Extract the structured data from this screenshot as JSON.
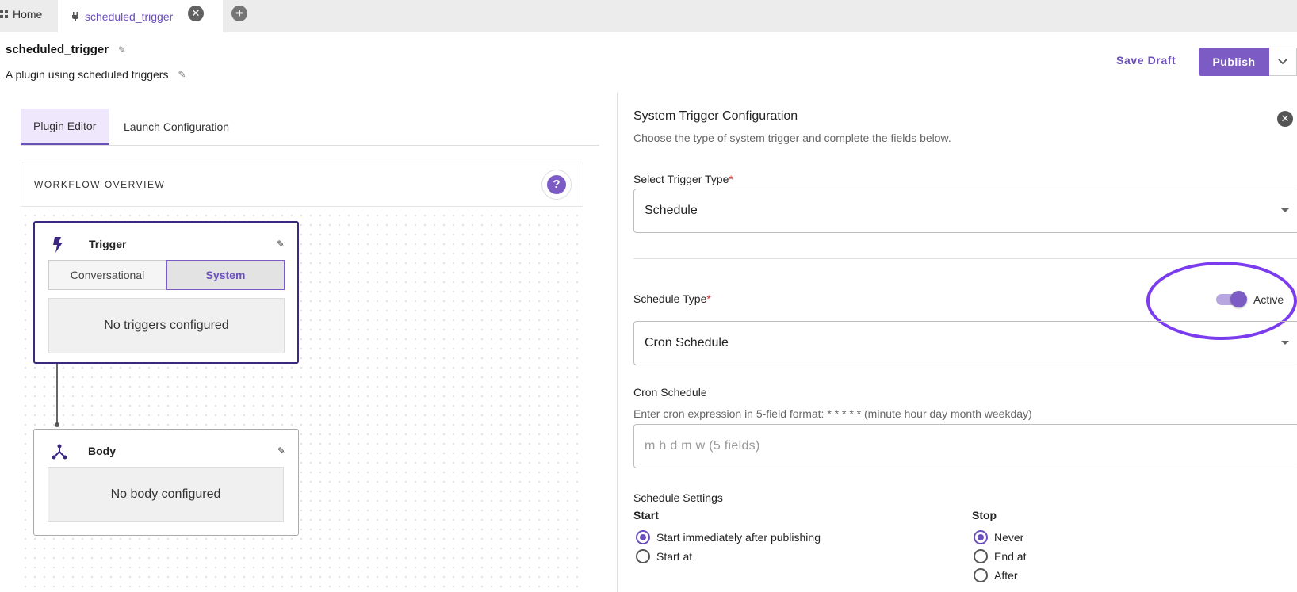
{
  "tabs": {
    "home_label": "Home",
    "active_label": "scheduled_trigger"
  },
  "header": {
    "title": "scheduled_trigger",
    "subtitle": "A plugin using scheduled triggers",
    "save_draft_label": "Save Draft",
    "publish_label": "Publish"
  },
  "editor": {
    "tabs": [
      "Plugin Editor",
      "Launch Configuration"
    ],
    "workflow_title": "WORKFLOW OVERVIEW",
    "trigger": {
      "title": "Trigger",
      "segments": [
        "Conversational",
        "System"
      ],
      "selected_segment": "System",
      "empty_text": "No triggers configured"
    },
    "body": {
      "title": "Body",
      "empty_text": "No body configured"
    }
  },
  "panel": {
    "title": "System Trigger Configuration",
    "description": "Choose the type of system trigger and complete the fields below.",
    "trigger_type_label": "Select Trigger Type",
    "trigger_type_value": "Schedule",
    "schedule_type_label": "Schedule Type",
    "schedule_type_value": "Cron Schedule",
    "active_label": "Active",
    "active_on": true,
    "cron_label": "Cron Schedule",
    "cron_hint": "Enter cron expression in 5-field format: * * * * * (minute hour day month weekday)",
    "cron_placeholder": "m h d m w (5 fields)",
    "settings_label": "Schedule Settings",
    "start": {
      "label": "Start",
      "options": [
        "Start immediately after publishing",
        "Start at"
      ],
      "selected": "Start immediately after publishing"
    },
    "stop": {
      "label": "Stop",
      "options": [
        "Never",
        "End at",
        "After"
      ],
      "selected": "Never"
    },
    "required_mark": "*"
  },
  "colors": {
    "accent": "#7c5cc4",
    "annotation": "#7b3cf0"
  }
}
